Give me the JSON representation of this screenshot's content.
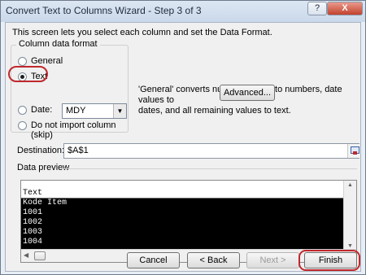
{
  "window": {
    "title": "Convert Text to Columns Wizard - Step 3 of 3",
    "help_label": "?",
    "close_label": "X"
  },
  "intro": "This screen lets you select each column and set the Data Format.",
  "column_format": {
    "group_label": "Column data format",
    "options": [
      {
        "label": "General",
        "selected": false
      },
      {
        "label": "Text",
        "selected": true
      },
      {
        "label": "Date:",
        "selected": false
      },
      {
        "label": "Do not import column (skip)",
        "selected": false
      }
    ],
    "date_format_value": "MDY"
  },
  "description_line1": "'General' converts numeric values to numbers, date values to",
  "description_line2": "dates, and all remaining values to text.",
  "advanced_label": "Advanced...",
  "destination": {
    "label": "Destination:",
    "value": "$A$1"
  },
  "data_preview": {
    "label": "Data preview",
    "column_header": "Text",
    "rows": [
      "Kode Item",
      "1001",
      "1002",
      "1003",
      "1004"
    ]
  },
  "buttons": {
    "cancel": "Cancel",
    "back": "< Back",
    "next": "Next >",
    "finish": "Finish"
  },
  "colors": {
    "highlight": "#c0282d",
    "preview_background": "#000000"
  }
}
